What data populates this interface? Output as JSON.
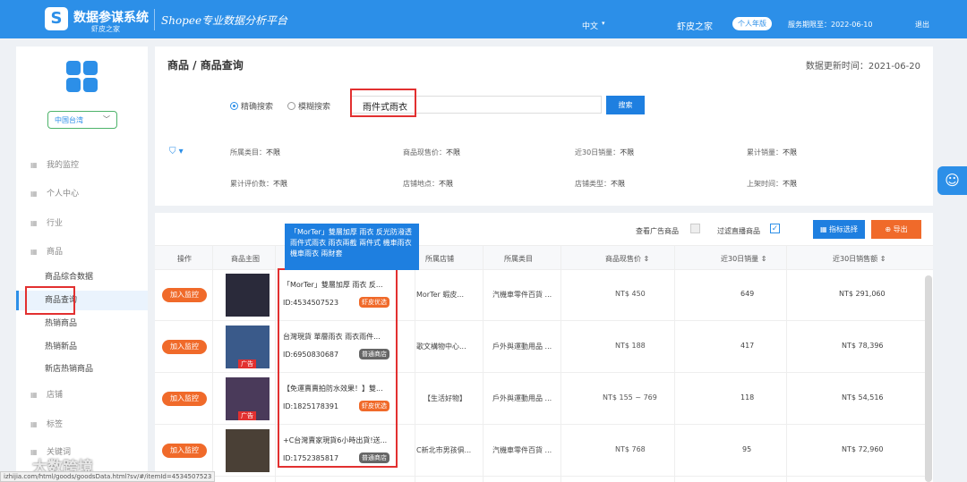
{
  "header": {
    "logo_char": "S",
    "app_title": "数据参谋系统",
    "app_sub": "虾皮之家",
    "slogan": "Shopee专业数据分析平台",
    "lang": "中文",
    "lang_caret": "▾",
    "user": "虾皮之家",
    "badge": "个人年版",
    "expire": "服务期限至：2022-06-10",
    "logout": "退出"
  },
  "sidebar": {
    "region": "中国台湾",
    "region_caret": "﹀",
    "items": [
      {
        "label": "我的监控",
        "icon": "▦"
      },
      {
        "label": "个人中心",
        "icon": "▦"
      },
      {
        "label": "行业",
        "icon": "▦"
      },
      {
        "label": "商品",
        "icon": "▦"
      },
      {
        "label": "商品综合数据"
      },
      {
        "label": "商品查询"
      },
      {
        "label": "热销商品"
      },
      {
        "label": "热销新品"
      },
      {
        "label": "新店热销商品"
      },
      {
        "label": "店铺",
        "icon": "▦"
      },
      {
        "label": "标签",
        "icon": "▦"
      },
      {
        "label": "关键词",
        "icon": "▦"
      }
    ]
  },
  "search": {
    "breadcrumb": "商品 / 商品查询",
    "updated": "数据更新时间：2021-06-20",
    "mode_exact": "精确搜索",
    "mode_fuzzy": "模糊搜索",
    "query": "雨件式雨衣",
    "button": "搜索",
    "filter_icon": "⛉ ▾",
    "filters": [
      {
        "label": "所属类目：",
        "value": "不限"
      },
      {
        "label": "商品现售价：",
        "value": "不限"
      },
      {
        "label": "近30日销量：",
        "value": "不限"
      },
      {
        "label": "累计销量：",
        "value": "不限"
      },
      {
        "label": "累计评价数：",
        "value": "不限"
      },
      {
        "label": "店铺地点：",
        "value": "不限"
      },
      {
        "label": "店铺类型：",
        "value": "不限"
      },
      {
        "label": "上架时间：",
        "value": "不限"
      }
    ]
  },
  "table": {
    "view_ads": "查看广告商品",
    "filter_live": "过滤直播商品",
    "check_mark": "✓",
    "indicator_btn": "▦ 指标选择",
    "export_btn": "⊕ 导出",
    "headers": {
      "op": "操作",
      "image": "商品主图",
      "shop": "所属店铺",
      "category": "所属类目",
      "price": "商品现售价 ⇕",
      "sales30": "近30日销量 ⇕",
      "revenue30": "近30日销售额 ⇕"
    },
    "tooltip": "「MorTer」雙層加厚 雨衣 反光防潑透 雨件式雨衣 雨衣兩截 兩件式 機車雨衣 機車雨衣 兩財套",
    "add_label": "加入监控",
    "ad_label": "广告",
    "rows": [
      {
        "name": "「MorTer」雙層加厚 雨衣 反...",
        "id": "ID:4534507523",
        "tag": "虾皮优选",
        "tag_color": "#f06a2a",
        "shop": "MorTer 蝦皮...",
        "category": "汽機車零件百貨 ...",
        "price": "NT$ 450",
        "sales": "649",
        "revenue": "NT$ 291,060",
        "ad": false
      },
      {
        "name": "台灣現貨 單層雨衣 雨衣雨件...",
        "id": "ID:6950830687",
        "tag": "普通商店",
        "tag_color": "#666666",
        "shop": "歌文構物中心...",
        "category": "戶外與運動用品 ...",
        "price": "NT$ 188",
        "sales": "417",
        "revenue": "NT$ 78,396",
        "ad": true
      },
      {
        "name": "【免運賣賣拍防水效果！】雙...",
        "id": "ID:1825178391",
        "tag": "虾皮优选",
        "tag_color": "#f06a2a",
        "shop": "【生活好物】",
        "category": "戶外與運動用品 ...",
        "price": "NT$ 155 ~ 769",
        "sales": "118",
        "revenue": "NT$ 54,516",
        "ad": true
      },
      {
        "name": "+C台灣賣家現貨6小時出貨!送...",
        "id": "ID:1752385817",
        "tag": "普通商店",
        "tag_color": "#666666",
        "shop": "C新北市男孩俱...",
        "category": "汽機車零件百貨 ...",
        "price": "NT$ 768",
        "sales": "95",
        "revenue": "NT$ 72,960",
        "ad": false
      }
    ]
  },
  "misc": {
    "help_icon": "☺",
    "watermark": "大数跨境",
    "status_url": "izhijia.com/html/goods/goodsData.html?sv/#/itemId=4534507523"
  }
}
